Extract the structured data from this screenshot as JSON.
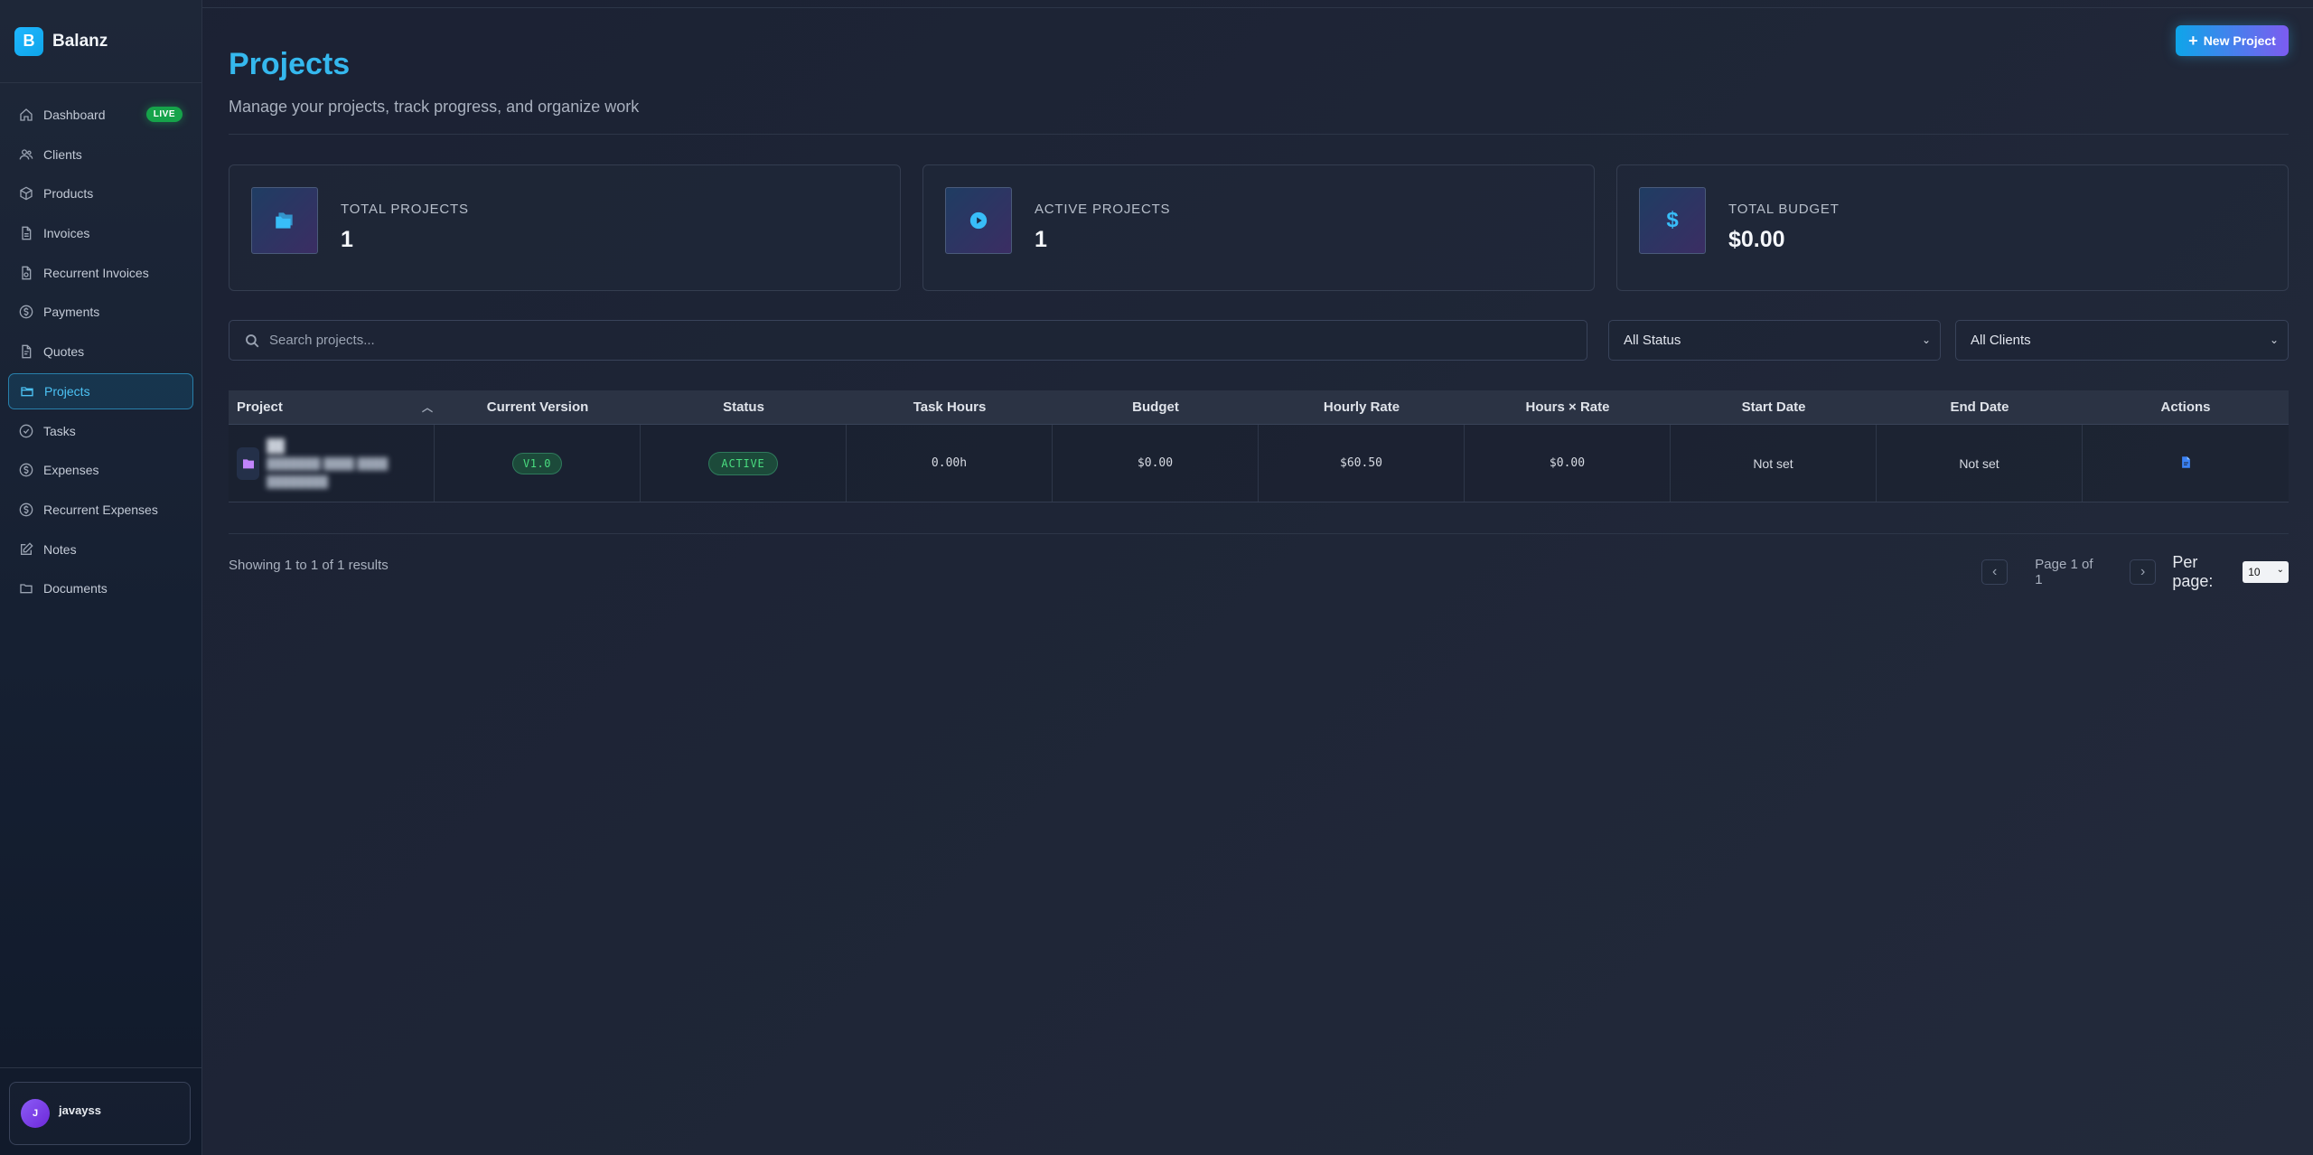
{
  "brand": {
    "logo_letter": "B",
    "name": "Balanz"
  },
  "sidebar": {
    "items": [
      {
        "label": "Dashboard",
        "icon": "home-icon",
        "badge": "LIVE"
      },
      {
        "label": "Clients",
        "icon": "users-icon"
      },
      {
        "label": "Products",
        "icon": "box-icon"
      },
      {
        "label": "Invoices",
        "icon": "file-icon"
      },
      {
        "label": "Recurrent Invoices",
        "icon": "file-repeat-icon"
      },
      {
        "label": "Payments",
        "icon": "dollar-circle-icon"
      },
      {
        "label": "Quotes",
        "icon": "quote-file-icon"
      },
      {
        "label": "Projects",
        "icon": "folder-icon",
        "active": true
      },
      {
        "label": "Tasks",
        "icon": "check-circle-icon"
      },
      {
        "label": "Expenses",
        "icon": "dollar-circle-icon"
      },
      {
        "label": "Recurrent Expenses",
        "icon": "dollar-circle-icon"
      },
      {
        "label": "Notes",
        "icon": "pencil-square-icon"
      },
      {
        "label": "Documents",
        "icon": "folder-open-icon"
      }
    ],
    "user": {
      "initial": "J",
      "name": "javayss"
    }
  },
  "page": {
    "title": "Projects",
    "subtitle": "Manage your projects, track progress, and organize work",
    "new_button": "New Project"
  },
  "stats": [
    {
      "label": "TOTAL PROJECTS",
      "value": "1",
      "icon": "folders-icon"
    },
    {
      "label": "ACTIVE PROJECTS",
      "value": "1",
      "icon": "play-circle-icon"
    },
    {
      "label": "TOTAL BUDGET",
      "value": "$0.00",
      "icon": "dollar-icon"
    }
  ],
  "filters": {
    "search_placeholder": "Search projects...",
    "status": "All Status",
    "clients": "All Clients"
  },
  "table": {
    "columns": [
      "Project",
      "Current Version",
      "Status",
      "Task Hours",
      "Budget",
      "Hourly Rate",
      "Hours × Rate",
      "Start Date",
      "End Date",
      "Actions"
    ],
    "rows": [
      {
        "project_name": "██",
        "project_client": "███████ ████ ████ ████████",
        "version": "V1.0",
        "status": "ACTIVE",
        "task_hours": "0.00h",
        "budget": "$0.00",
        "hourly_rate": "$60.50",
        "hours_rate": "$0.00",
        "start_date": "Not set",
        "end_date": "Not set"
      }
    ]
  },
  "pagination": {
    "results": "Showing 1 to 1 of 1 results",
    "page_info": "Page 1 of 1",
    "per_page_label": "Per page:",
    "per_page_value": "10"
  },
  "colors": {
    "accent": "#35b8ee",
    "success": "#4ade80",
    "live": "#16a34a",
    "button_gradient_start": "#0ea5e9",
    "button_gradient_end": "#7c5cf0"
  }
}
